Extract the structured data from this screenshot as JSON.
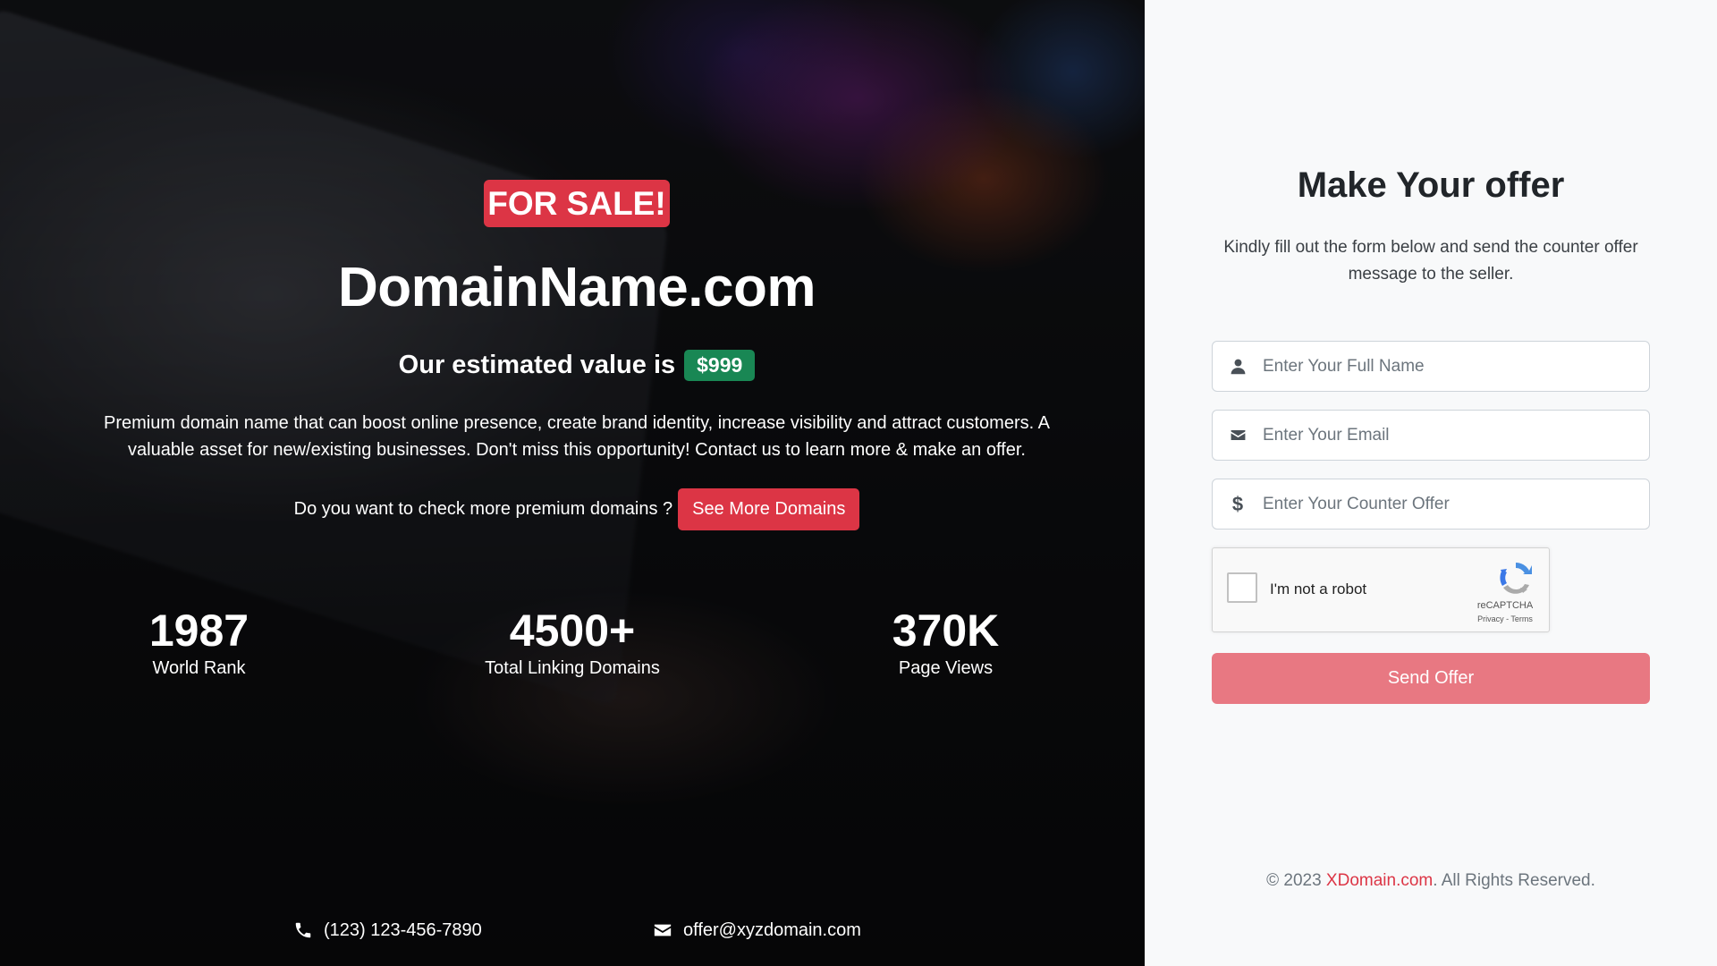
{
  "hero": {
    "badge": "FOR SALE!",
    "domain": "DomainName.com",
    "value_label": "Our estimated value is",
    "price": "$999",
    "description": "Premium domain name that can boost online presence, create brand identity, increase visibility and attract customers. A valuable asset for new/existing businesses. Don't miss this opportunity! Contact us to learn more & make an offer.",
    "more_prompt": "Do you want to check more premium domains ?",
    "more_button": "See More Domains",
    "stats": [
      {
        "value": "1987",
        "label": "World Rank"
      },
      {
        "value": "4500+",
        "label": "Total Linking Domains"
      },
      {
        "value": "370K",
        "label": "Page Views"
      }
    ],
    "contact": {
      "phone": "(123) 123-456-7890",
      "email": "offer@xyzdomain.com",
      "phone_icon": "phone-icon",
      "email_icon": "envelope-icon"
    }
  },
  "form": {
    "title": "Make Your offer",
    "subtitle": "Kindly fill out the form below and send the counter offer message to the seller.",
    "fields": [
      {
        "placeholder": "Enter Your Full Name",
        "icon": "user-icon"
      },
      {
        "placeholder": "Enter Your Email",
        "icon": "envelope-icon"
      },
      {
        "placeholder": "Enter Your Counter Offer",
        "icon": "dollar-icon"
      }
    ],
    "captcha": {
      "label": "I'm not a robot",
      "brand": "reCAPTCHA",
      "terms": "Privacy - Terms"
    },
    "submit": "Send Offer"
  },
  "footer": {
    "prefix": "© 2023 ",
    "brand": "XDomain.com",
    "suffix": ". All Rights Reserved."
  },
  "colors": {
    "accent_red": "#dc3545",
    "price_green": "#198754",
    "submit_pink": "#e87882"
  }
}
